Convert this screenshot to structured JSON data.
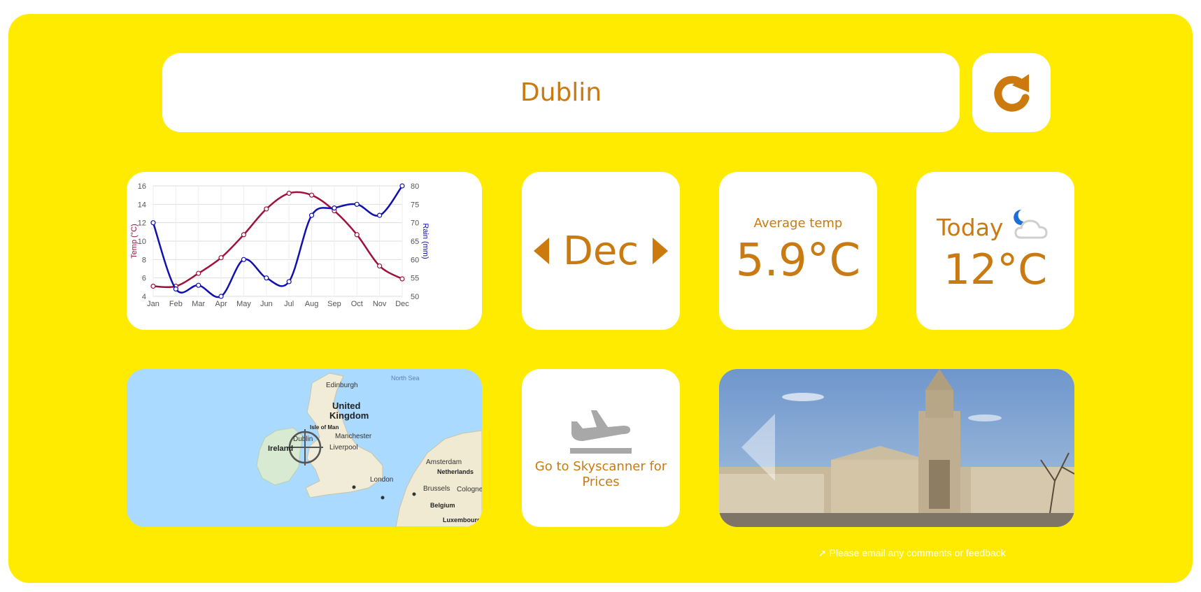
{
  "search": {
    "city": "Dublin"
  },
  "month_selector": {
    "month": "Dec"
  },
  "average": {
    "label": "Average temp",
    "value": "5.9°C"
  },
  "today": {
    "label": "Today",
    "value": "12°C"
  },
  "skyscanner": {
    "label_line1": "Go to Skyscanner for",
    "label_line2": "Prices"
  },
  "feedback": {
    "text": "Please email any comments or feedback"
  },
  "map_labels": {
    "north_sea": "North Sea",
    "edinburgh": "Edinburgh",
    "uk_line1": "United",
    "uk_line2": "Kingdom",
    "isle_of_man": "Isle of Man",
    "dublin": "Dublin",
    "ireland": "Ireland",
    "manchester": "Manchester",
    "liverpool": "Liverpool",
    "amsterdam": "Amsterdam",
    "netherlands": "Netherlands",
    "london": "London",
    "brussels": "Brussels",
    "cologne": "Cologne",
    "belgium": "Belgium",
    "luxembourg": "Luxembourg"
  },
  "colors": {
    "accent": "#cc7a0e",
    "background": "#ffeb00",
    "card": "#ffffff",
    "temp_line": "#a0103c",
    "rain_line": "#1010b0"
  },
  "chart_data": {
    "type": "line",
    "categories": [
      "Jan",
      "Feb",
      "Mar",
      "Apr",
      "May",
      "Jun",
      "Jul",
      "Aug",
      "Sep",
      "Oct",
      "Nov",
      "Dec"
    ],
    "series": [
      {
        "name": "",
        "axis": "left",
        "values": [
          5.1,
          5.1,
          6.5,
          8.2,
          10.7,
          13.5,
          15.2,
          15.0,
          13.3,
          10.7,
          7.3,
          5.9
        ]
      },
      {
        "name": "",
        "axis": "right",
        "values": [
          70,
          52,
          53,
          50,
          60,
          55,
          54,
          72,
          74,
          75,
          72,
          80
        ]
      }
    ],
    "ylabel": "Temp (°C)",
    "ylabel_right": "Rain (mm)",
    "ylim": [
      4,
      16
    ],
    "yticks": [
      4,
      6,
      8,
      10,
      12,
      14,
      16
    ],
    "ylim_right": [
      50,
      80
    ],
    "yticks_right": [
      50,
      55,
      60,
      65,
      70,
      75,
      80
    ],
    "grid": true
  }
}
